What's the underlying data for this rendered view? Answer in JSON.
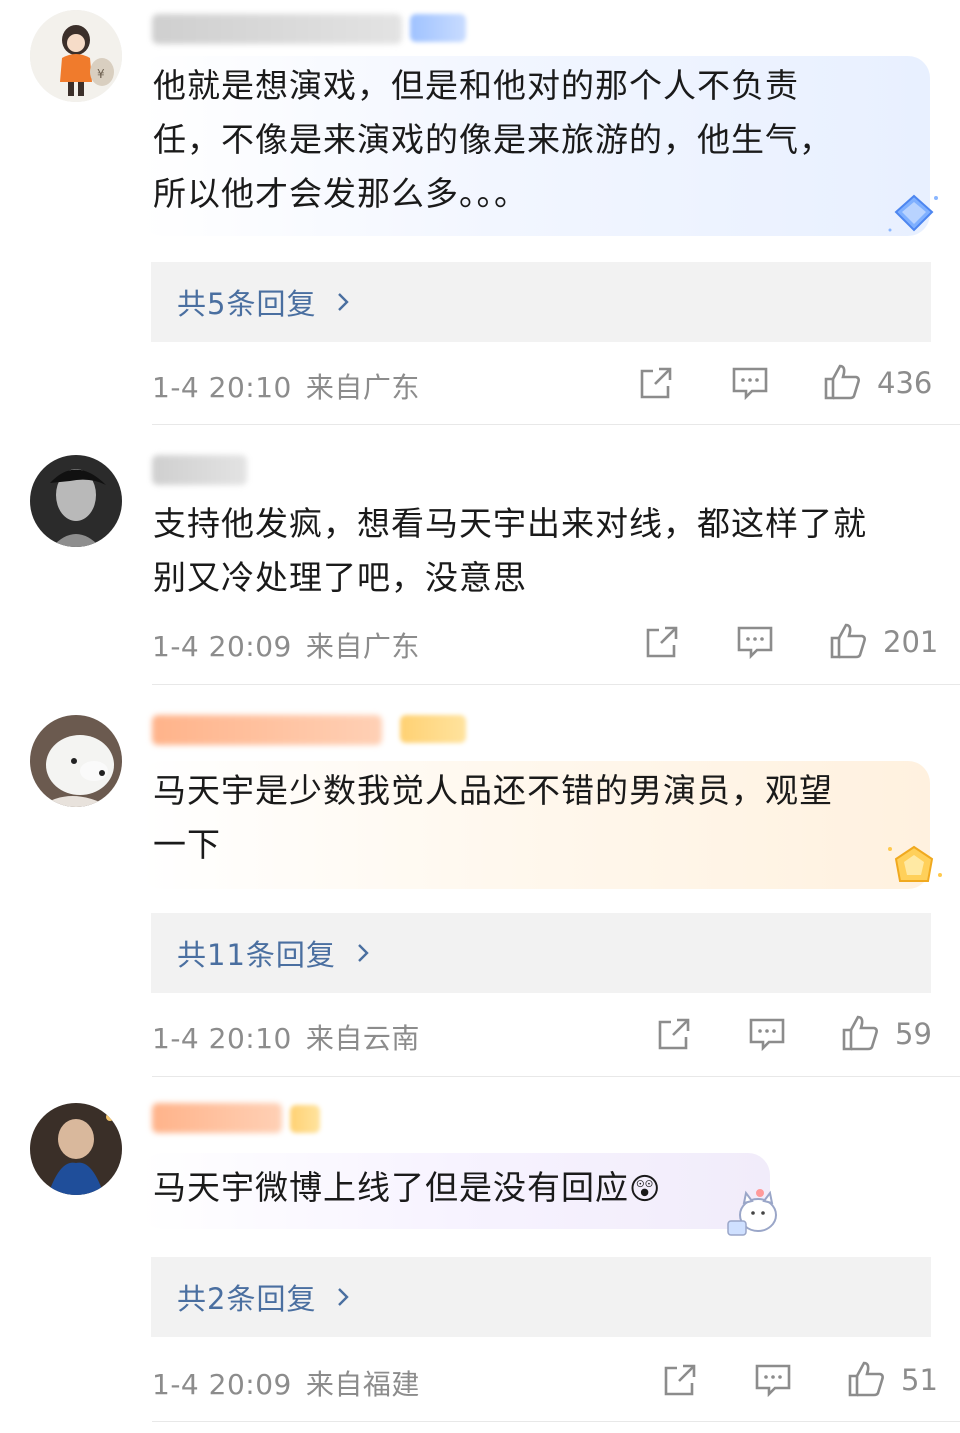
{
  "comments": [
    {
      "text": "他就是想演戏，但是和他对的那个人不负责\n任，不像是来演戏的像是来旅游的，他生气，\n所以他才会发那么多。。。",
      "replies_label": "共5条回复",
      "time": "1-4 20:10",
      "location": "来自广东",
      "likes": "436"
    },
    {
      "text": "支持他发疯，想看马天宇出来对线，都这样了就\n别又冷处理了吧，没意思",
      "time": "1-4 20:09",
      "location": "来自广东",
      "likes": "201"
    },
    {
      "text": "马天宇是少数我觉人品还不错的男演员，观望\n一下",
      "replies_label": "共11条回复",
      "time": "1-4 20:10",
      "location": "来自云南",
      "likes": "59"
    },
    {
      "text": "马天宇微博上线了但是没有回应",
      "emoji": "😲",
      "replies_label": "共2条回复",
      "time": "1-4 20:09",
      "location": "来自福建",
      "likes": "51"
    }
  ],
  "icons": {
    "share": "share-icon",
    "comment": "comment-icon",
    "like": "thumbs-up-icon",
    "chevron": "chevron-right-icon"
  },
  "colors": {
    "reply_link": "#4a6fa0",
    "meta_text": "#8c8c8c",
    "reply_bg": "#f2f2f2"
  }
}
